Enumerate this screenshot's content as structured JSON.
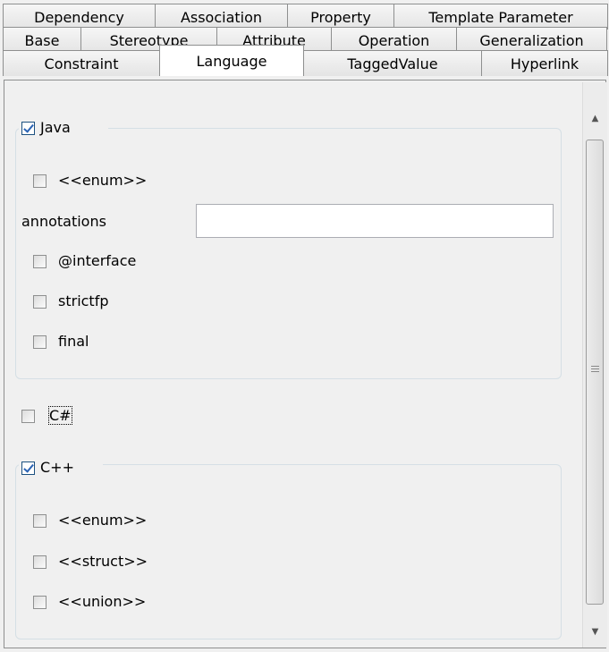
{
  "tabs": {
    "row1": [
      "Dependency",
      "Association",
      "Property",
      "Template Parameter"
    ],
    "row2": [
      "Base",
      "Stereotype",
      "Attribute",
      "Operation",
      "Generalization"
    ],
    "row3": [
      "Constraint",
      "Language",
      "TaggedValue",
      "Hyperlink"
    ],
    "selected": "Language"
  },
  "java": {
    "label": "Java",
    "checked": true,
    "enum_label": "<<enum>>",
    "enum_checked": false,
    "annotations_label": "annotations",
    "annotations_value": "",
    "interface_label": "@interface",
    "interface_checked": false,
    "strictfp_label": "strictfp",
    "strictfp_checked": false,
    "final_label": "final",
    "final_checked": false
  },
  "csharp": {
    "label": "C#",
    "checked": false
  },
  "cpp": {
    "label": "C++",
    "checked": true,
    "enum_label": "<<enum>>",
    "enum_checked": false,
    "struct_label": "<<struct>>",
    "struct_checked": false,
    "union_label": "<<union>>",
    "union_checked": false
  },
  "scrollbar": {
    "up": "▲",
    "down": "▼"
  }
}
